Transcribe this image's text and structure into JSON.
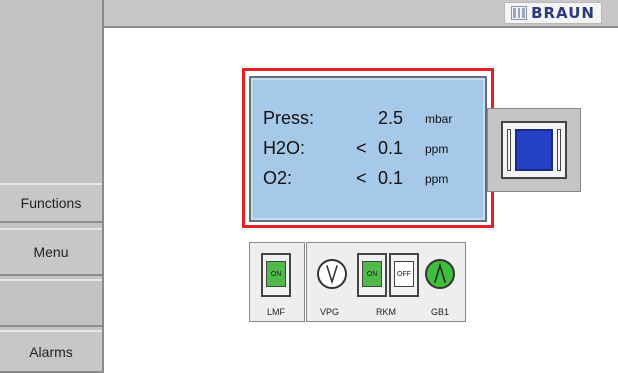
{
  "brand": {
    "name": "BRAUN"
  },
  "sidebar": {
    "buttons": [
      {
        "label": "Functions"
      },
      {
        "label": "Menu"
      },
      {
        "label": "Alarms"
      }
    ]
  },
  "display": {
    "rows": [
      {
        "label": "Press:",
        "comparator": "",
        "value": "2.5",
        "unit": "mbar"
      },
      {
        "label": "H2O:",
        "comparator": "<",
        "value": "0.1",
        "unit": "ppm"
      },
      {
        "label": "O2:",
        "comparator": "<",
        "value": "0.1",
        "unit": "ppm"
      }
    ],
    "highlight_color": "#e52020",
    "background_color": "#a7c9e9"
  },
  "controls": {
    "lmf": {
      "state": "ON",
      "label": "LMF"
    },
    "vpg": {
      "label": "VPG",
      "icon": "pump-icon",
      "active": false
    },
    "rkm": {
      "label": "RKM",
      "on_label": "ON",
      "off_label": "OFF"
    },
    "gb1": {
      "label": "GB1",
      "icon": "blower-icon",
      "active": true
    },
    "on_color": "#4fba4a"
  }
}
